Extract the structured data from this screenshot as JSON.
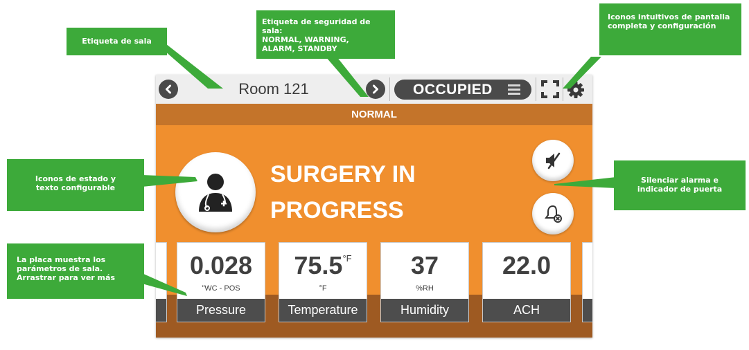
{
  "callouts": {
    "room_label": "Etiqueta de sala",
    "safety_label": {
      "line1": "Etiqueta de seguridad de sala:",
      "line2": "NORMAL, WARNING,",
      "line3": "ALARM, STANDBY"
    },
    "icons": {
      "line1": "Iconos intuitivos de pantalla",
      "line2": "completa y configuración"
    },
    "status": {
      "line1": "Iconos de estado y",
      "line2": "texto configurable"
    },
    "silence": {
      "line1": "Silenciar alarma e",
      "line2": "indicador de puerta"
    },
    "plate": {
      "line1": "La placa muestra los",
      "line2": "parámetros de sala.",
      "line3": "Arrastrar para ver más"
    }
  },
  "device": {
    "room_title": "Room 121",
    "occupancy": "OCCUPIED",
    "safety_status": "NORMAL",
    "status_text_line1": "SURGERY IN",
    "status_text_line2": "PROGRESS",
    "tiles": [
      {
        "value": "0.028",
        "unit_sup": "",
        "unit": "\"WC - POS",
        "name": "Pressure"
      },
      {
        "value": "75.5",
        "unit_sup": "°F",
        "unit": "°F",
        "name": "Temperature"
      },
      {
        "value": "37",
        "unit_sup": "",
        "unit": "%RH",
        "name": "Humidity"
      },
      {
        "value": "22.0",
        "unit_sup": "",
        "unit": "",
        "name": "ACH"
      }
    ]
  },
  "colors": {
    "callout_green": "#3daa3a",
    "screen_orange": "#f08f2e",
    "status_bar_brown": "#c4742a",
    "dark_gray": "#4a4a4a"
  }
}
